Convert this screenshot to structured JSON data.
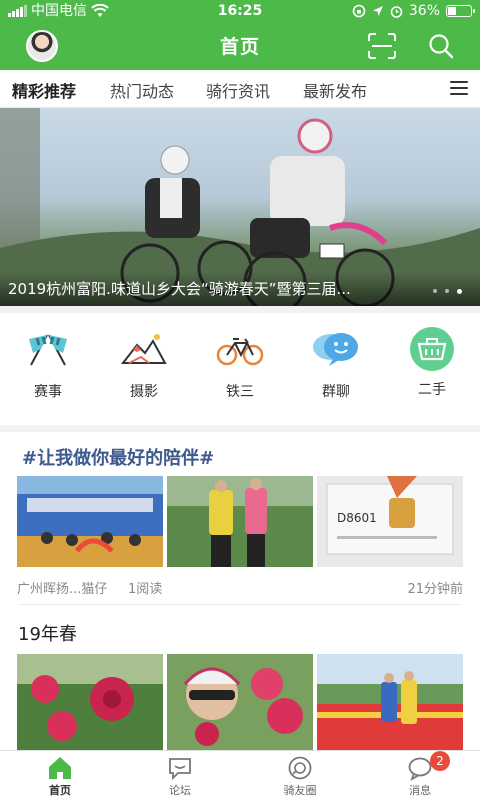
{
  "status_bar": {
    "carrier": "中国电信",
    "time": "16:25",
    "battery": "36%",
    "battery_level": 0.36
  },
  "header": {
    "title": "首页"
  },
  "tabs": [
    {
      "label": "精彩推荐",
      "active": true
    },
    {
      "label": "热门动态",
      "active": false
    },
    {
      "label": "骑行资讯",
      "active": false
    },
    {
      "label": "最新发布",
      "active": false
    }
  ],
  "banner": {
    "caption": "2019杭州富阳.味道山乡大会“骑游春天”暨第三届...",
    "dots": 3,
    "active_dot": 2
  },
  "categories": [
    {
      "label": "赛事",
      "icon": "racing-flags-icon"
    },
    {
      "label": "摄影",
      "icon": "photography-mountain-icon"
    },
    {
      "label": "铁三",
      "icon": "bicycle-icon"
    },
    {
      "label": "群聊",
      "icon": "chat-bubble-icon"
    },
    {
      "label": "二手",
      "icon": "shopping-basket-icon"
    }
  ],
  "post1": {
    "hashtag": "#让我做你最好的陪伴#",
    "author": "广州晖扬...猫仔",
    "reads": "1阅读",
    "time": "21分钟前",
    "photo_numbers": [
      "D8601"
    ]
  },
  "post2": {
    "title": "19年春"
  },
  "bottom_nav": [
    {
      "label": "首页",
      "icon": "home-icon",
      "active": true
    },
    {
      "label": "论坛",
      "icon": "forum-icon",
      "active": false
    },
    {
      "label": "骑友圈",
      "icon": "riders-circle-icon",
      "active": false
    },
    {
      "label": "消息",
      "icon": "message-icon",
      "active": false,
      "badge": "2"
    }
  ],
  "colors": {
    "brand_green": "#4cb948",
    "badge_red": "#e84b3c",
    "hashtag_blue": "#3e5a8c"
  }
}
